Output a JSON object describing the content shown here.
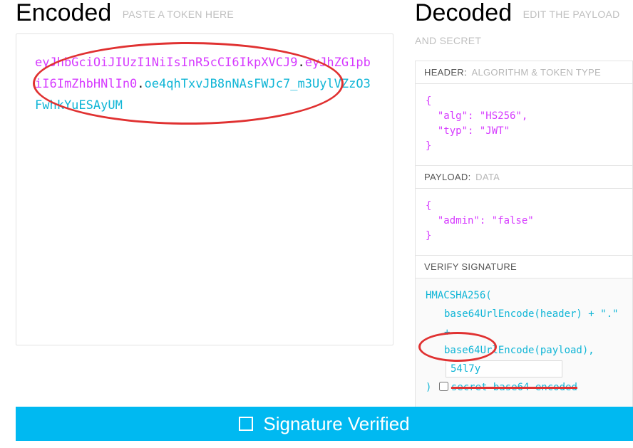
{
  "encoded": {
    "heading": "Encoded",
    "hint": "PASTE A TOKEN HERE",
    "token_header": "eyJhbGciOiJIUzI1NiIsInR5cCI6IkpXVCJ9",
    "token_payload": "eyJhZG1pbiI6ImZhbHNlIn0",
    "token_sig": "oe4qhTxvJB8nNAsFWJc7_m3UylVZzO3FwhkYuESAyUM"
  },
  "decoded": {
    "heading": "Decoded",
    "hint": "EDIT THE PAYLOAD AND SECRET",
    "header_section": {
      "label": "HEADER:",
      "sub": "ALGORITHM & TOKEN TYPE",
      "body": "{\n  \"alg\": \"HS256\",\n  \"typ\": \"JWT\"\n}"
    },
    "payload_section": {
      "label": "PAYLOAD:",
      "sub": "DATA",
      "body": "{\n  \"admin\": \"false\"\n}"
    },
    "verify_section": {
      "label": "VERIFY SIGNATURE",
      "algo": "HMACSHA256(",
      "l1": "base64UrlEncode(header) + \".\" +",
      "l2": "base64UrlEncode(payload),",
      "secret_value": "54l7y",
      "close": ")",
      "chk_label": "secret base64 encoded"
    }
  },
  "status": {
    "text": "Signature Verified"
  }
}
